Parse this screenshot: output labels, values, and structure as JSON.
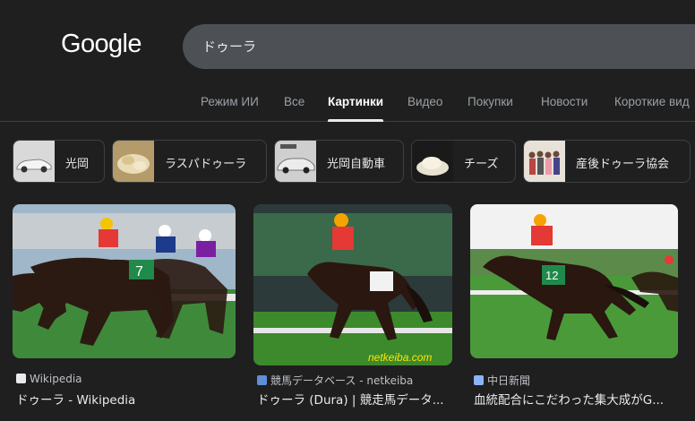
{
  "header": {
    "logo": "Google",
    "query": "ドゥーラ"
  },
  "tabs": [
    {
      "label": "Режим ИИ"
    },
    {
      "label": "Все"
    },
    {
      "label": "Картинки"
    },
    {
      "label": "Видео"
    },
    {
      "label": "Покупки"
    },
    {
      "label": "Новости"
    },
    {
      "label": "Короткие вид"
    }
  ],
  "chips": [
    {
      "label": "光岡"
    },
    {
      "label": "ラスパドゥーラ"
    },
    {
      "label": "光岡自動車"
    },
    {
      "label": "チーズ"
    },
    {
      "label": "産後ドゥーラ協会"
    }
  ],
  "results": [
    {
      "source": "Wikipedia",
      "title": "ドゥーラ - Wikipedia",
      "badge": "7"
    },
    {
      "source": "競馬データベース - netkeiba",
      "title": "ドゥーラ (Dura) | 競走馬データ...",
      "badge": "",
      "watermark": "netkeiba.com"
    },
    {
      "source": "中日新聞",
      "title": "血統配合にこだわった集大成がG...",
      "badge": "12"
    }
  ]
}
